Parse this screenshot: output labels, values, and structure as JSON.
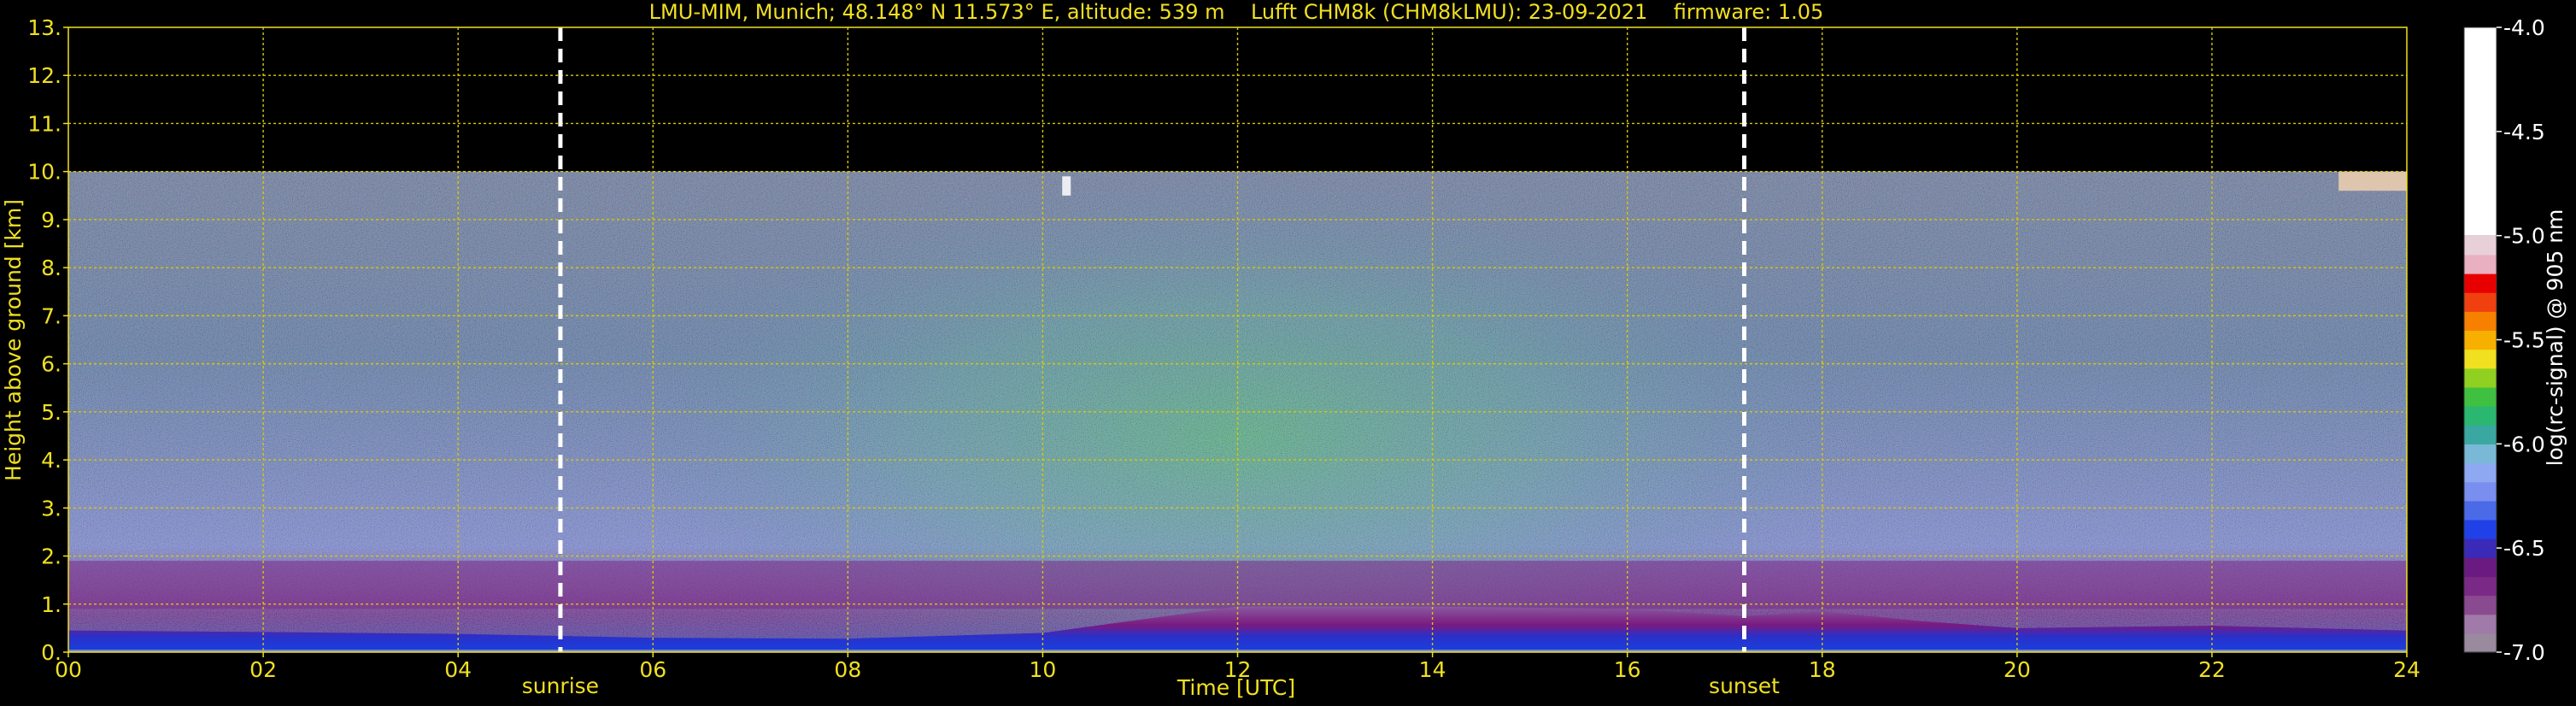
{
  "chart_data": {
    "type": "heatmap",
    "title": "LMU-MIM, Munich; 48.148° N 11.573° E, altitude: 539 m    Lufft CHM8k (CHM8kLMU): 23-09-2021    firmware: 1.05",
    "xlabel": "Time [UTC]",
    "ylabel": "Height above ground [km]",
    "xlim": [
      0,
      24
    ],
    "ylim": [
      0,
      13
    ],
    "x_ticks": [
      0,
      2,
      4,
      6,
      8,
      10,
      12,
      14,
      16,
      18,
      20,
      22,
      24
    ],
    "x_tick_labels": [
      "00",
      "02",
      "04",
      "06",
      "08",
      "10",
      "12",
      "14",
      "16",
      "18",
      "20",
      "22",
      "24"
    ],
    "y_ticks": [
      0,
      1,
      2,
      3,
      4,
      5,
      6,
      7,
      8,
      9,
      10,
      11,
      12,
      13
    ],
    "y_tick_labels": [
      "0.",
      "1.",
      "2.",
      "3.",
      "4.",
      "5.",
      "6.",
      "7.",
      "8.",
      "9.",
      "10.",
      "11.",
      "12.",
      "13."
    ],
    "grid": true,
    "data_top_km": 10,
    "markers": [
      {
        "label": "sunrise",
        "time": 5.05
      },
      {
        "label": "sunset",
        "time": 17.2
      }
    ],
    "colorbar": {
      "label": "log(rc-signal) @ 905 nm",
      "range": [
        -7.0,
        -4.0
      ],
      "ticks": [
        -4.0,
        -4.5,
        -5.0,
        -5.5,
        -6.0,
        -6.5,
        -7.0
      ],
      "tick_labels": [
        "-4.0",
        "-4.5",
        "-5.0",
        "-5.5",
        "-6.0",
        "-6.5",
        "-7.0"
      ],
      "colors": [
        "#9a8a9e",
        "#a07aa8",
        "#8a4a90",
        "#7a2a86",
        "#6a1a80",
        "#3a2ab8",
        "#2040e8",
        "#4a6ae8",
        "#7a8ef0",
        "#8ea8f2",
        "#7ab8d8",
        "#3aa8a0",
        "#2ab870",
        "#40c040",
        "#90d020",
        "#f0e020",
        "#f8b000",
        "#f88000",
        "#f04010",
        "#e80000",
        "#e8b0c0",
        "#e8d0d8",
        "#ffffff"
      ]
    }
  },
  "colors": {
    "text": "#f0e020",
    "grid": "#d8c800",
    "marker": "#ffffff",
    "colorbar_text": "#ffffff",
    "background": "#000000"
  }
}
